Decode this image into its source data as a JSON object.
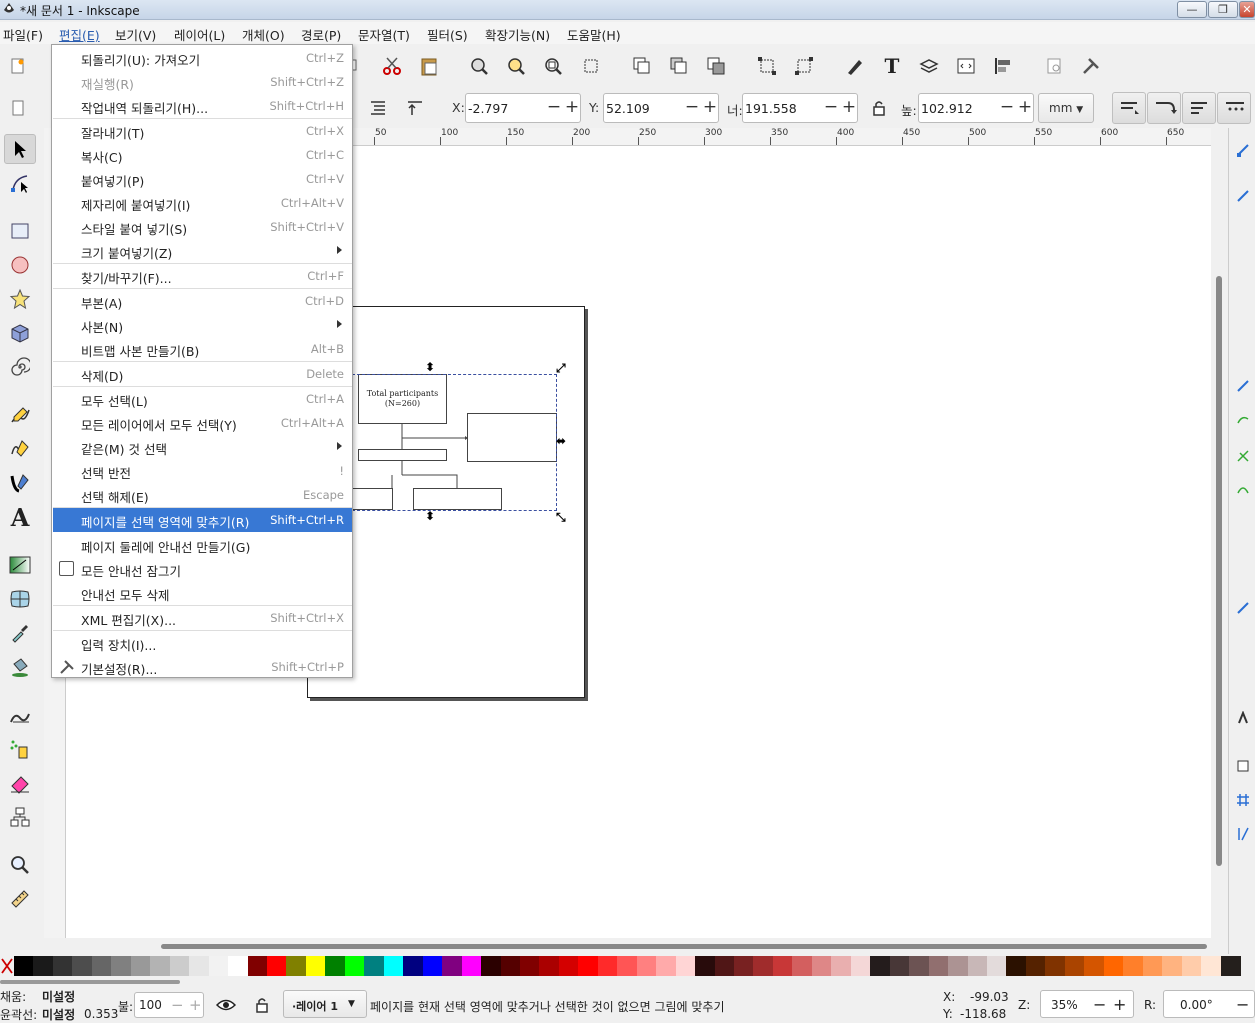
{
  "window": {
    "title": "*새 문서 1 - Inkscape",
    "controls": [
      "—",
      "❐",
      "✕"
    ]
  },
  "menubar": {
    "items": [
      "파일(F)",
      "편집(E)",
      "보기(V)",
      "레이어(L)",
      "개체(O)",
      "경로(P)",
      "문자열(T)",
      "필터(S)",
      "확장기능(N)",
      "도움말(H)"
    ]
  },
  "edit_menu": {
    "items": [
      {
        "label": "되돌리기(U): 가져오기",
        "shortcut": "Ctrl+Z"
      },
      {
        "label": "재실행(R)",
        "shortcut": "Shift+Ctrl+Z"
      },
      {
        "label": "작업내역 되돌리기(H)...",
        "shortcut": "Shift+Ctrl+H"
      },
      {
        "label": "잘라내기(T)",
        "shortcut": "Ctrl+X"
      },
      {
        "label": "복사(C)",
        "shortcut": "Ctrl+C"
      },
      {
        "label": "붙여넣기(P)",
        "shortcut": "Ctrl+V"
      },
      {
        "label": "제자리에 붙여넣기(I)",
        "shortcut": "Ctrl+Alt+V"
      },
      {
        "label": "스타일 붙여 넣기(S)",
        "shortcut": "Shift+Ctrl+V"
      },
      {
        "label": "크기 붙여넣기(Z)",
        "shortcut": ""
      },
      {
        "label": "찾기/바꾸기(F)...",
        "shortcut": "Ctrl+F"
      },
      {
        "label": "부본(A)",
        "shortcut": "Ctrl+D"
      },
      {
        "label": "사본(N)",
        "shortcut": ""
      },
      {
        "label": "비트맵 사본 만들기(B)",
        "shortcut": "Alt+B"
      },
      {
        "label": "삭제(D)",
        "shortcut": "Delete"
      },
      {
        "label": "모두 선택(L)",
        "shortcut": "Ctrl+A"
      },
      {
        "label": "모든 레이어에서 모두 선택(Y)",
        "shortcut": "Ctrl+Alt+A"
      },
      {
        "label": "같은(M) 것 선택",
        "shortcut": ""
      },
      {
        "label": "선택 반전",
        "shortcut": "!"
      },
      {
        "label": "선택 해제(E)",
        "shortcut": "Escape"
      },
      {
        "label": "페이지를 선택 영역에 맞추기(R)",
        "shortcut": "Shift+Ctrl+R"
      },
      {
        "label": "페이지 둘레에 안내선 만들기(G)",
        "shortcut": ""
      },
      {
        "label": "모든 안내선  잠그기",
        "shortcut": ""
      },
      {
        "label": "안내선 모두 삭제",
        "shortcut": ""
      },
      {
        "label": "XML 편집기(X)...",
        "shortcut": "Shift+Ctrl+X"
      },
      {
        "label": "입력 장치(I)...",
        "shortcut": ""
      },
      {
        "label": "기본설정(R)...",
        "shortcut": "Shift+Ctrl+P"
      }
    ]
  },
  "tool_controls": {
    "x_label": "X:",
    "x_value": "-2.797",
    "y_label": "Y:",
    "y_value": "52.109",
    "w_label": "너:",
    "w_value": "191.558",
    "h_label": "높:",
    "h_value": "102.912",
    "unit": "mm",
    "minus": "−",
    "plus": "+"
  },
  "ruler": {
    "labels": [
      "50",
      "100",
      "150",
      "200",
      "250",
      "300",
      "350",
      "400",
      "450",
      "500",
      "550",
      "600",
      "650"
    ]
  },
  "diagram": {
    "box1_line1": "Total participants",
    "box1_line2": "(N=260)"
  },
  "palette": {
    "colors": [
      "#000000",
      "#1a1a1a",
      "#333333",
      "#4d4d4d",
      "#666666",
      "#808080",
      "#999999",
      "#b3b3b3",
      "#cccccc",
      "#e6e6e6",
      "#f2f2f2",
      "#ffffff",
      "#800000",
      "#ff0000",
      "#808000",
      "#ffff00",
      "#008000",
      "#00ff00",
      "#008080",
      "#00ffff",
      "#000080",
      "#0000ff",
      "#800080",
      "#ff00ff",
      "#2b0000",
      "#550000",
      "#800000",
      "#aa0000",
      "#d40000",
      "#ff0000",
      "#ff2a2a",
      "#ff5555",
      "#ff8080",
      "#ffaaaa",
      "#ffd5d5",
      "#280b0b",
      "#501616",
      "#782121",
      "#a02c2c",
      "#c83737",
      "#d35f5f",
      "#de8787",
      "#e9afaf",
      "#f4d7d7",
      "#241c1c",
      "#483737",
      "#6c5353",
      "#916f6f",
      "#ac9393",
      "#c8b7b7",
      "#e3dbdb",
      "#2b1100",
      "#552200",
      "#803300",
      "#aa4400",
      "#d45500",
      "#ff6600",
      "#ff7f2a",
      "#ff9955",
      "#ffb380",
      "#ffccaa",
      "#ffe6d5",
      "#241f1c"
    ]
  },
  "status": {
    "fill_label": "채움:",
    "fill_value": "미설정",
    "stroke_label": "윤곽선:",
    "stroke_value": "미설정",
    "stroke_width": "0.353",
    "opacity_label": "불:",
    "opacity_value": "100",
    "layer": "·레이어 1",
    "message": "페이지를 현재 선택 영역에 맞추거나 선택한 것이 없으면 그림에 맞추기",
    "cx_label": "X:",
    "cx_value": "-99.03",
    "cy_label": "Y:",
    "cy_value": "-118.68",
    "zoom_label": "Z:",
    "zoom_value": "35%",
    "rot_label": "R:",
    "rot_value": "0.00°"
  }
}
